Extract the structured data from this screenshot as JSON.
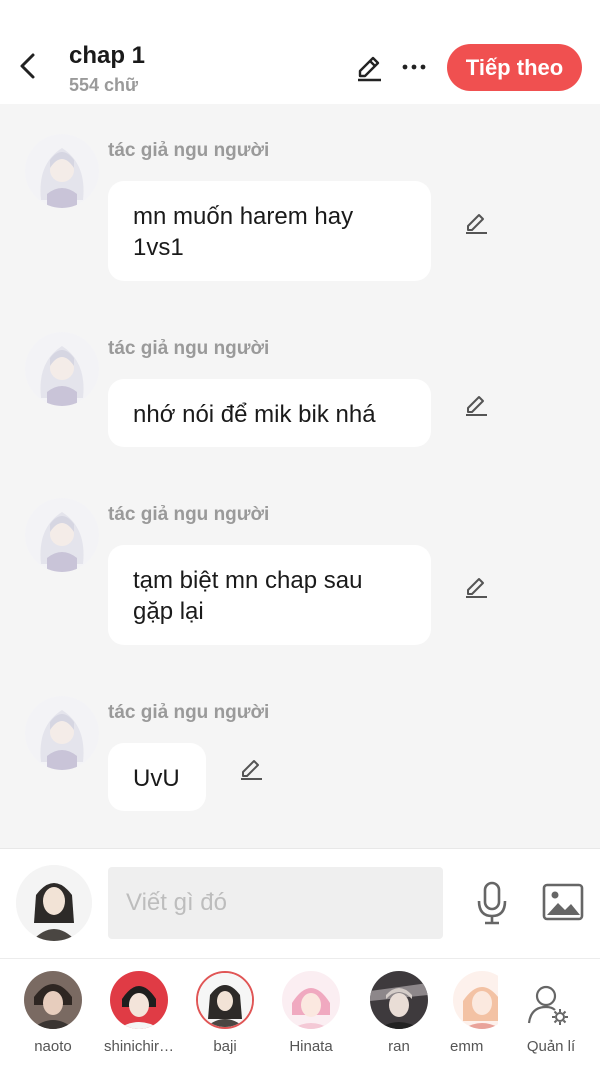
{
  "header": {
    "title": "chap 1",
    "subtitle": "554 chữ",
    "next_label": "Tiếp theo"
  },
  "messages": [
    {
      "author": "tác giả ngu người",
      "text": "mn muốn harem hay 1vs1"
    },
    {
      "author": "tác giả ngu người",
      "text": "nhớ nói để mik bik nhá"
    },
    {
      "author": "tác giả ngu người",
      "text": "tạm biệt mn chap sau gặp lại"
    },
    {
      "author": "tác giả ngu người",
      "text": "UvU"
    }
  ],
  "composer": {
    "placeholder": "Viết gì đó"
  },
  "characters": [
    {
      "name": "naoto",
      "selected": false
    },
    {
      "name": "shinichir…",
      "selected": false
    },
    {
      "name": "baji",
      "selected": true
    },
    {
      "name": "Hinata",
      "selected": false
    },
    {
      "name": "ran",
      "selected": false
    },
    {
      "name": "emm",
      "selected": false
    }
  ],
  "manage_label": "Quản lí",
  "colors": {
    "accent": "#f05050",
    "background": "#f5f5f5",
    "bubble": "#ffffff",
    "muted_text": "#9a9a9a"
  }
}
